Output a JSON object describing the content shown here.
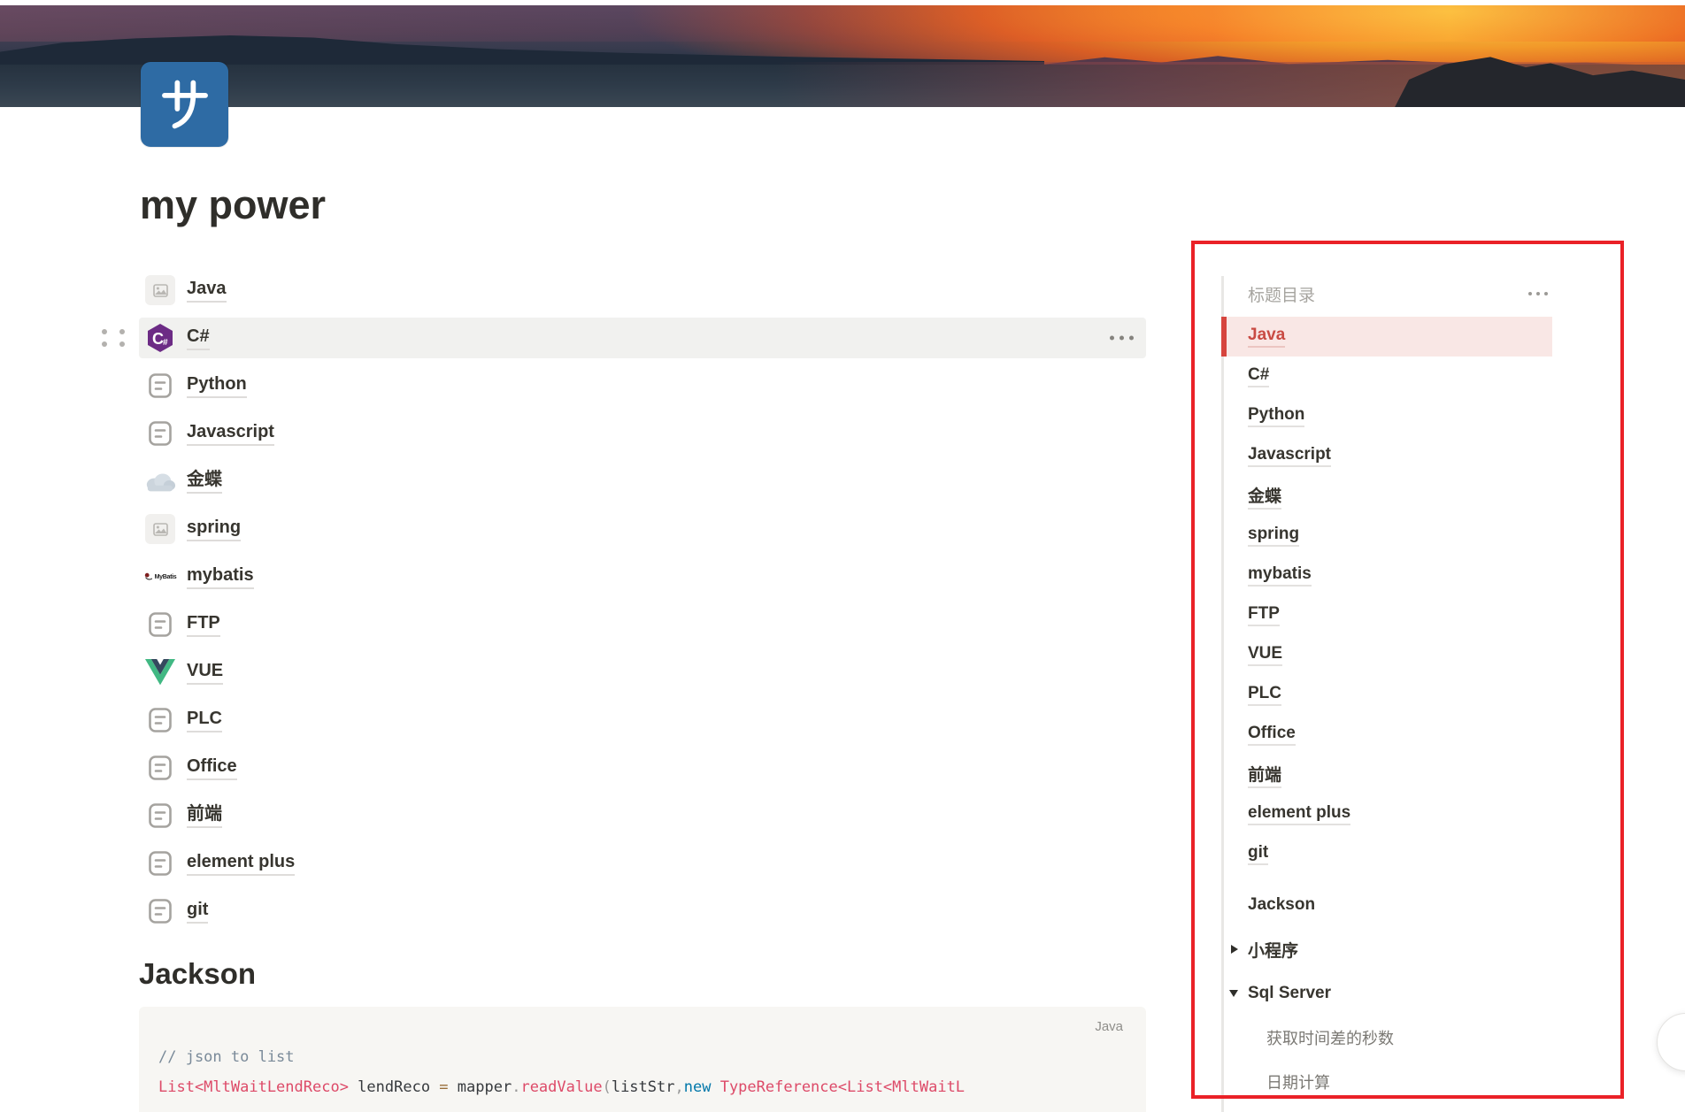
{
  "page": {
    "title": "my power",
    "icon_glyph": "サ",
    "section_heading": "Jackson"
  },
  "colors": {
    "annotation_red": "#ea2127",
    "toc_active_bar": "#d6453e",
    "toc_active_text": "#c94b43",
    "toc_active_bg": "#f9e7e5",
    "page_icon_blue": "#2e6ba4",
    "csharp_purple": "#6c2b85",
    "vue_green": "#41b883",
    "vue_dark": "#35495e",
    "code_bg": "#f7f6f3",
    "hover_row_bg": "#f1f1ef"
  },
  "content_links": [
    {
      "label": "Java",
      "icon": "image-placeholder-icon"
    },
    {
      "label": "C#",
      "icon": "csharp-icon"
    },
    {
      "label": "Python",
      "icon": "document-icon"
    },
    {
      "label": "Javascript",
      "icon": "document-icon"
    },
    {
      "label": "金蝶",
      "icon": "cloud-icon"
    },
    {
      "label": "spring",
      "icon": "image-placeholder-icon"
    },
    {
      "label": "mybatis",
      "icon": "mybatis-icon",
      "icon_text": "MyBatis"
    },
    {
      "label": "FTP",
      "icon": "document-icon"
    },
    {
      "label": "VUE",
      "icon": "vue-icon"
    },
    {
      "label": "PLC",
      "icon": "document-icon"
    },
    {
      "label": "Office",
      "icon": "document-icon"
    },
    {
      "label": "前端",
      "icon": "document-icon"
    },
    {
      "label": "element plus",
      "icon": "document-icon"
    },
    {
      "label": "git",
      "icon": "document-icon"
    }
  ],
  "code_block": {
    "language_label": "Java",
    "line1": [
      {
        "text": "// json to list",
        "type": "comment"
      }
    ],
    "line2": [
      {
        "text": "List<MltWaitLendReco>",
        "type": "class"
      },
      {
        "text": " lendReco ",
        "type": "plain"
      },
      {
        "text": "=",
        "type": "operator"
      },
      {
        "text": " mapper",
        "type": "plain"
      },
      {
        "text": ".",
        "type": "punctuation"
      },
      {
        "text": "readValue",
        "type": "function"
      },
      {
        "text": "(",
        "type": "punctuation"
      },
      {
        "text": "listStr",
        "type": "plain"
      },
      {
        "text": ",",
        "type": "punctuation"
      },
      {
        "text": "new",
        "type": "keyword"
      },
      {
        "text": " ",
        "type": "plain"
      },
      {
        "text": "TypeReference<List<MltWaitL",
        "type": "class"
      }
    ]
  },
  "toc": {
    "header": "标题目录",
    "items": [
      {
        "label": "Java",
        "type": "link",
        "active": true
      },
      {
        "label": "C#",
        "type": "link"
      },
      {
        "label": "Python",
        "type": "link"
      },
      {
        "label": "Javascript",
        "type": "link"
      },
      {
        "label": "金蝶",
        "type": "link"
      },
      {
        "label": "spring",
        "type": "link"
      },
      {
        "label": "mybatis",
        "type": "link"
      },
      {
        "label": "FTP",
        "type": "link"
      },
      {
        "label": "VUE",
        "type": "link"
      },
      {
        "label": "PLC",
        "type": "link"
      },
      {
        "label": "Office",
        "type": "link"
      },
      {
        "label": "前端",
        "type": "link"
      },
      {
        "label": "element plus",
        "type": "link"
      },
      {
        "label": "git",
        "type": "link"
      },
      {
        "label": "Jackson",
        "type": "section"
      },
      {
        "label": "小程序",
        "type": "section",
        "state": "collapsed"
      },
      {
        "label": "Sql Server",
        "type": "section",
        "state": "expanded"
      },
      {
        "label": "获取时间差的秒数",
        "type": "child"
      },
      {
        "label": "日期计算",
        "type": "child"
      }
    ]
  }
}
